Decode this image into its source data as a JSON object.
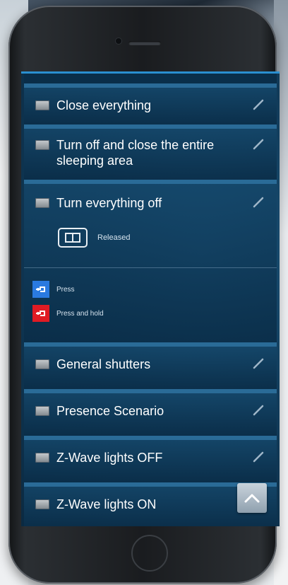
{
  "scenarios": [
    {
      "label": "Close everything"
    },
    {
      "label": "Turn off and close the entire sleeping area"
    },
    {
      "label": "Turn everything off",
      "state": "Released"
    },
    {
      "label": "General shutters"
    },
    {
      "label": "Presence Scenario"
    },
    {
      "label": "Z-Wave lights OFF"
    },
    {
      "label": "Z-Wave lights ON"
    }
  ],
  "legend": {
    "press": {
      "label": "Press",
      "color": "#2a7ae0",
      "icon": "hand-tap-icon"
    },
    "press_hold": {
      "label": "Press and hold",
      "color": "#e01b24",
      "icon": "hand-hold-icon"
    }
  },
  "icons": {
    "row": "scenario-icon",
    "edit": "pencil-icon",
    "state": "wall-switch-icon",
    "scroll": "chevron-up-icon"
  },
  "colors": {
    "accent": "#2a8fd0",
    "panel": "#123d5c"
  }
}
